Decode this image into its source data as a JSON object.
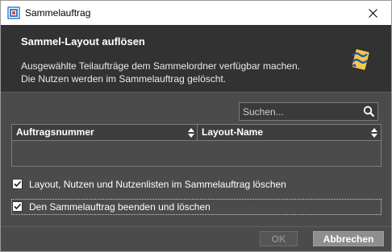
{
  "window": {
    "title": "Sammelauftrag",
    "close_glyph": "✕"
  },
  "header": {
    "title": "Sammel-Layout auflösen",
    "description": "Ausgewählte Teilaufträge dem Sammelordner verfügbar machen. Die Nutzen werden im Sammelauftrag gelöscht.",
    "icon": "dissolve-layout-icon"
  },
  "search": {
    "placeholder": "Suchen...",
    "value": "",
    "icon": "search-icon"
  },
  "table": {
    "columns": [
      "Auftragsnummer",
      "Layout-Name"
    ],
    "rows": []
  },
  "options": [
    {
      "label": "Layout, Nutzen und Nutzenlisten im Sammelauftrag löschen",
      "checked": true
    },
    {
      "label": "Den Sammelauftrag beenden und löschen",
      "checked": true
    }
  ],
  "footer": {
    "ok_label": "OK",
    "cancel_label": "Abbrechen"
  }
}
